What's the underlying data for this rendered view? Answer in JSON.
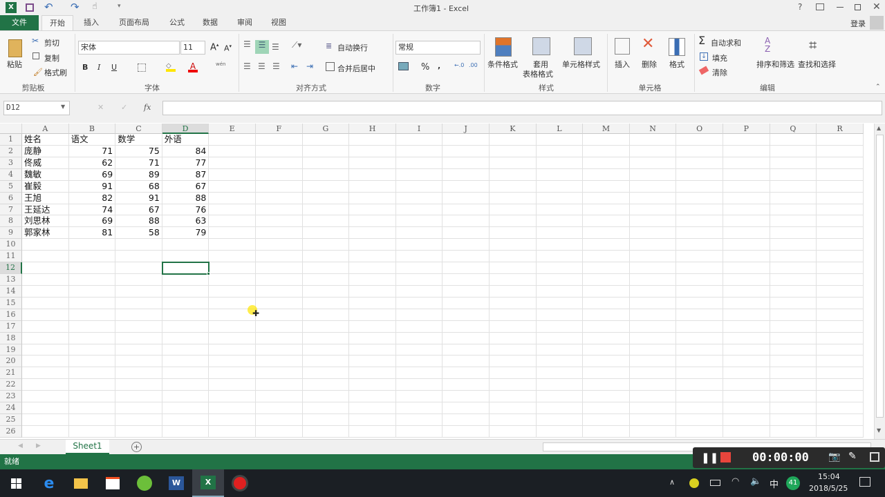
{
  "window": {
    "title": "工作簿1 - Excel",
    "help": "?",
    "login": "登录"
  },
  "quick_access": [
    "save-icon",
    "undo-icon",
    "redo-icon",
    "touch-mode-icon",
    "customize-icon"
  ],
  "tabs": [
    "文件",
    "开始",
    "插入",
    "页面布局",
    "公式",
    "数据",
    "审阅",
    "视图"
  ],
  "active_tab": "开始",
  "ribbon": {
    "clipboard": {
      "paste": "粘贴",
      "cut": "剪切",
      "copy": "复制",
      "format_painter": "格式刷",
      "group": "剪贴板"
    },
    "font": {
      "name": "宋体",
      "size": "11",
      "bold": "B",
      "italic": "I",
      "underline": "U",
      "phonetic": "wén",
      "group": "字体"
    },
    "alignment": {
      "wrap": "自动换行",
      "merge": "合并后居中",
      "group": "对齐方式"
    },
    "number": {
      "format": "常规",
      "percent": "%",
      "comma": ",",
      "group": "数字"
    },
    "styles": {
      "conditional": "条件格式",
      "table_format_1": "套用",
      "table_format_2": "表格格式",
      "cell_styles": "单元格样式",
      "group": "样式"
    },
    "cells": {
      "insert": "插入",
      "delete": "删除",
      "format": "格式",
      "group": "单元格"
    },
    "editing": {
      "autosum": "自动求和",
      "fill": "填充",
      "clear": "清除",
      "sort": "排序和筛选",
      "find": "查找和选择",
      "group": "编辑"
    }
  },
  "formula_bar": {
    "name_box": "D12",
    "fx": "fx",
    "value": ""
  },
  "columns": [
    "A",
    "B",
    "C",
    "D",
    "E",
    "F",
    "G",
    "H",
    "I",
    "J",
    "K",
    "L",
    "M",
    "N",
    "O",
    "P",
    "Q",
    "R"
  ],
  "row_count": 26,
  "selected_cell": "D12",
  "sheet": {
    "header": [
      "姓名",
      "语文",
      "数学",
      "外语"
    ],
    "rows": [
      [
        "庞静",
        "71",
        "75",
        "84"
      ],
      [
        "佟威",
        "62",
        "71",
        "77"
      ],
      [
        "魏敏",
        "69",
        "89",
        "87"
      ],
      [
        "崔毅",
        "91",
        "68",
        "67"
      ],
      [
        "王旭",
        "82",
        "91",
        "88"
      ],
      [
        "王延达",
        "74",
        "67",
        "76"
      ],
      [
        "刘思林",
        "69",
        "88",
        "63"
      ],
      [
        "郭家林",
        "81",
        "58",
        "79"
      ]
    ]
  },
  "sheet_tabs": [
    "Sheet1"
  ],
  "status": "就绪",
  "recorder": {
    "time": "00:00:00",
    "stop_color": "#e8453c"
  },
  "taskbar": {
    "ime": "中",
    "badge": "41",
    "time": "15:04",
    "date": "2018/5/25"
  },
  "colors": {
    "accent": "#217346"
  }
}
